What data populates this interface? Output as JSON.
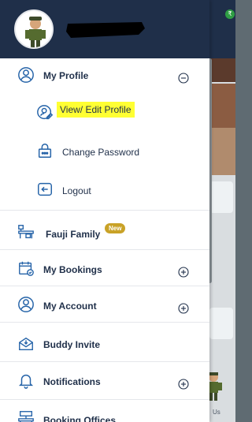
{
  "drawer": {
    "profile": {
      "section_label": "My Profile",
      "items": [
        {
          "label": "View/ Edit Profile"
        },
        {
          "label": "Change Password"
        },
        {
          "label": "Logout"
        }
      ]
    },
    "menu": [
      {
        "label": "Fauji Family",
        "badge": "New"
      },
      {
        "label": "My Bookings"
      },
      {
        "label": "My Account"
      },
      {
        "label": "Buddy Invite"
      },
      {
        "label": "Notifications"
      },
      {
        "label": "Booking Offices"
      }
    ]
  },
  "background": {
    "bottom_text": "Us"
  },
  "colors": {
    "header": "#1f2f49",
    "text": "#1f2f49",
    "icon": "#2563a8",
    "highlight": "#ffff33",
    "badge": "#c9a227"
  }
}
